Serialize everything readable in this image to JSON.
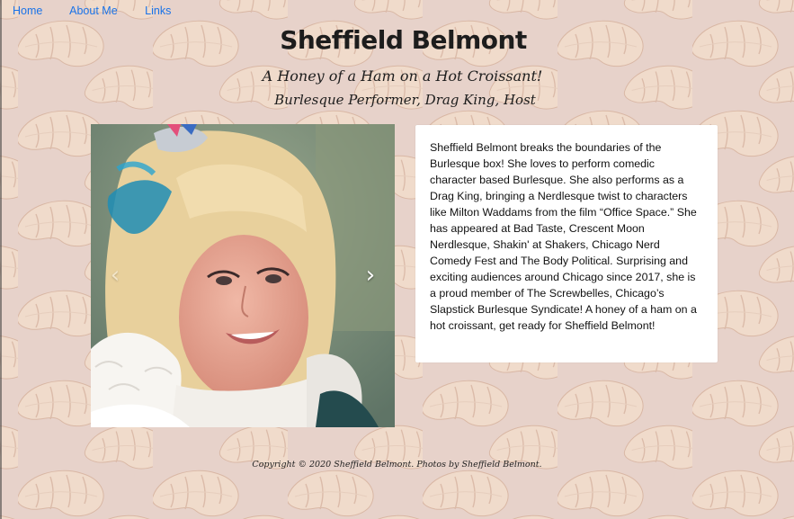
{
  "nav": {
    "home": "Home",
    "about": "About Me",
    "links": "Links"
  },
  "header": {
    "title": "Sheffield Belmont",
    "tagline": "A Honey of a Ham on a Hot Croissant!",
    "subtitle": "Burlesque Performer, Drag King, Host"
  },
  "carousel": {
    "prev_icon": "chevron-left-icon",
    "next_icon": "chevron-right-icon",
    "prev_glyph": "‹",
    "next_glyph": "›"
  },
  "bio": {
    "text": "Sheffield Belmont breaks the boundaries of the Burlesque box! She loves to perform comedic character based Burlesque. She also performs as a Drag King, bringing a Nerdlesque twist to characters like Milton Waddams from the film “Office Space.” She has appeared at Bad Taste, Crescent Moon Nerdlesque, Shakin' at Shakers, Chicago Nerd Comedy Fest and The Body Political. Surprising and exciting audiences around Chicago since 2017, she is a proud member of The Screwbelles, Chicago’s Slapstick Burlesque Syndicate! A honey of a ham on a hot croissant, get ready for Sheffield Belmont!"
  },
  "footer": {
    "text": "Copyright © 2020 Sheffield Belmont. Photos by Sheffield Belmont."
  },
  "colors": {
    "background": "#e7d2ca",
    "link": "#1a73e8",
    "card": "#ffffff",
    "croissant": "#efd6c4"
  }
}
